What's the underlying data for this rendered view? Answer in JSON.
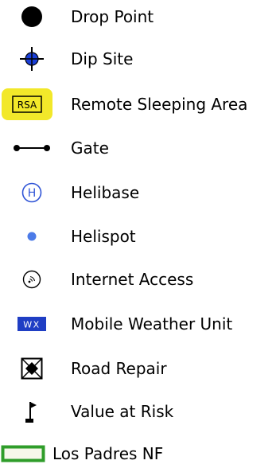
{
  "legend": {
    "items": [
      {
        "label": "Drop Point",
        "icon": "drop-point-icon"
      },
      {
        "label": "Dip Site",
        "icon": "dip-site-icon"
      },
      {
        "label": "Remote Sleeping Area",
        "icon": "remote-sleeping-area-icon",
        "icon_text": "RSA",
        "icon_color": "#f2e82a"
      },
      {
        "label": "Gate",
        "icon": "gate-icon"
      },
      {
        "label": "Helibase",
        "icon": "helibase-icon",
        "icon_text": "H",
        "icon_color": "#2f54d6"
      },
      {
        "label": "Helispot",
        "icon": "helispot-icon",
        "icon_color": "#4c7be8"
      },
      {
        "label": "Internet Access",
        "icon": "internet-access-icon"
      },
      {
        "label": "Mobile Weather Unit",
        "icon": "mobile-weather-unit-icon",
        "icon_text": "WX",
        "icon_color": "#1f3ec4"
      },
      {
        "label": "Road Repair",
        "icon": "road-repair-icon"
      },
      {
        "label": "Value at Risk",
        "icon": "value-at-risk-icon"
      },
      {
        "label": "Los Padres NF",
        "icon": "national-forest-boundary-icon",
        "icon_color": "#2f9d2a"
      }
    ]
  }
}
